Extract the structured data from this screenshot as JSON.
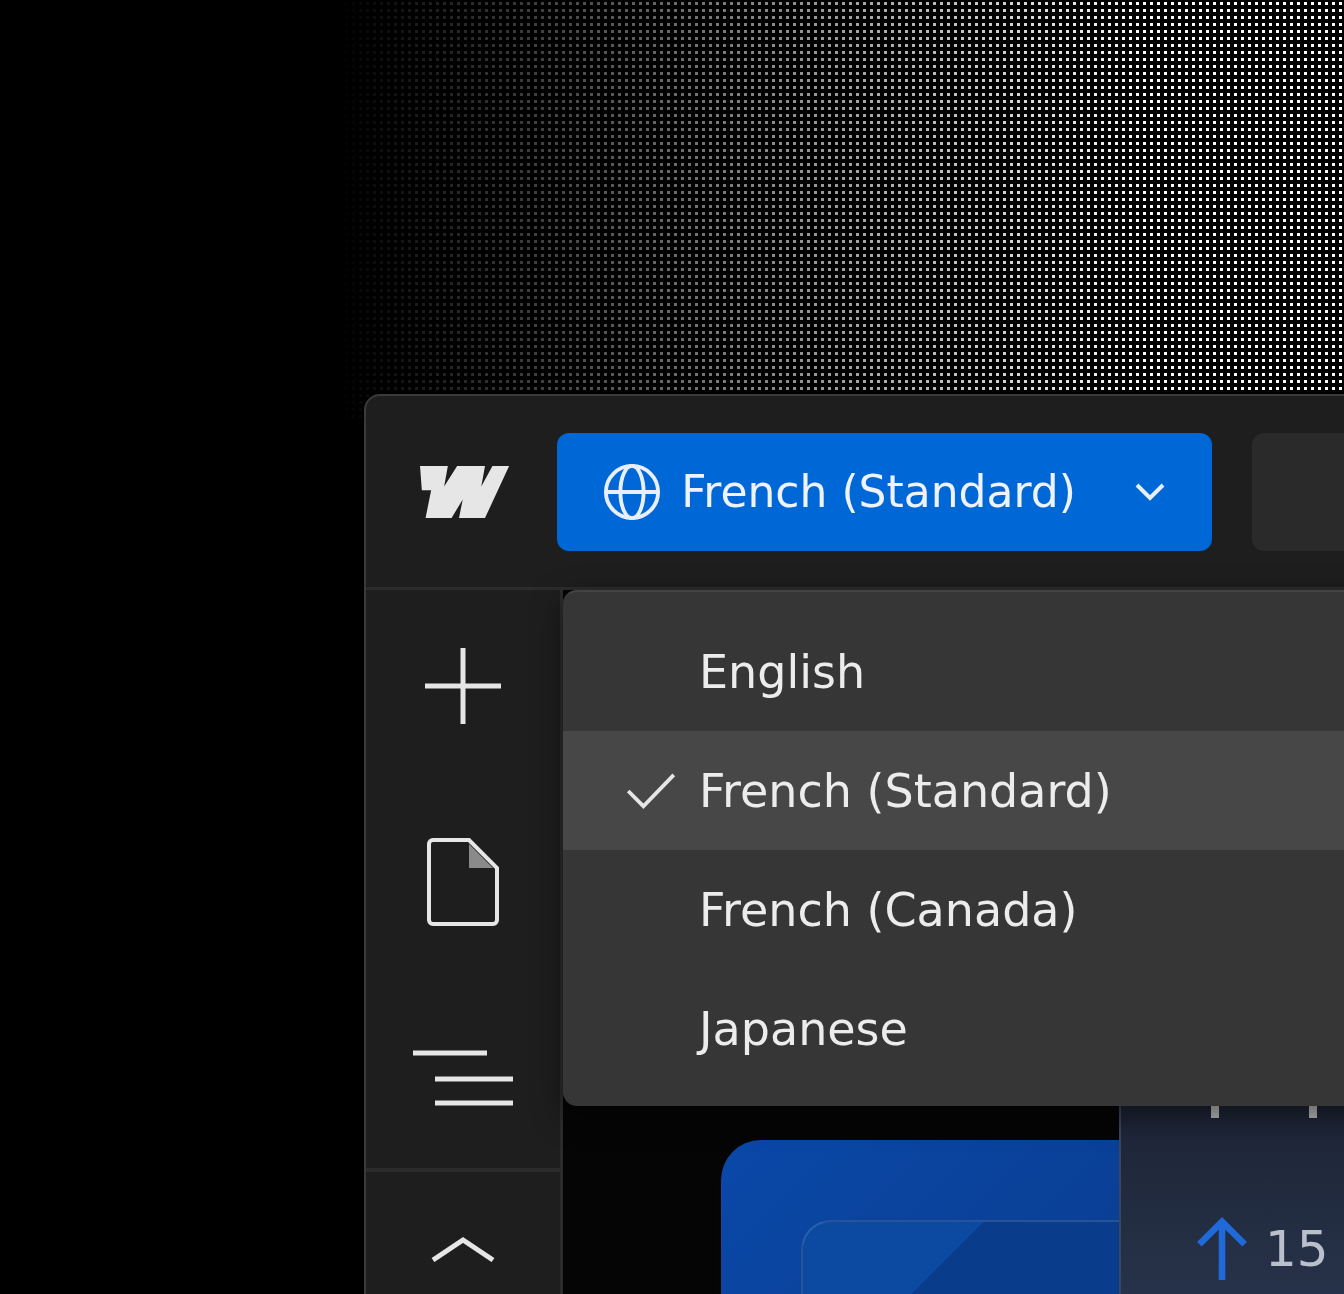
{
  "toolbar": {
    "language_button": {
      "label": "French (Standard)"
    }
  },
  "language_menu": {
    "items": [
      {
        "label": "English",
        "selected": false
      },
      {
        "label": "French (Standard)",
        "selected": true
      },
      {
        "label": "French (Canada)",
        "selected": false
      },
      {
        "label": "Japanese",
        "selected": false
      }
    ]
  },
  "canvas": {
    "stat_card": {
      "value": "15"
    }
  }
}
